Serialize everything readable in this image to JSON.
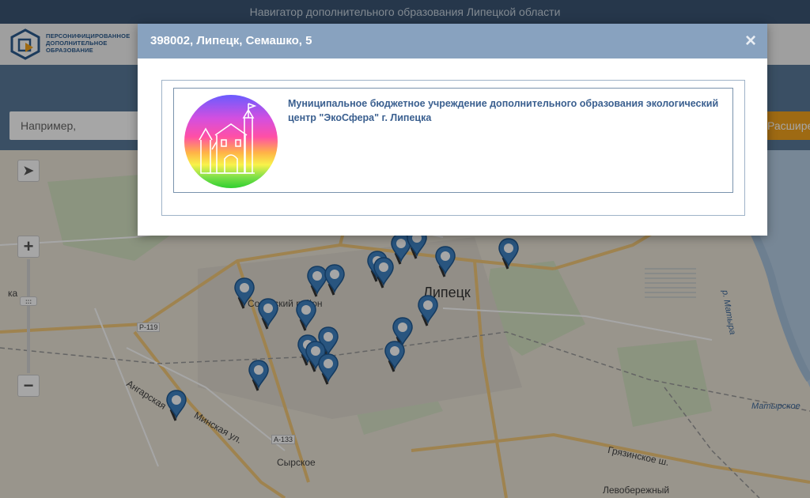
{
  "topbar": {
    "title": "Навигатор дополнительного образования Липецкой области"
  },
  "header": {
    "logo_text": [
      "ПЕРСОНИФИЦИРОВАННОЕ",
      "ДОПОЛНИТЕЛЬНОЕ",
      "ОБРАЗОВАНИЕ"
    ]
  },
  "search": {
    "placeholder": "Например, Робототехника"
  },
  "extended_search": {
    "label": "Расширенный поиск"
  },
  "map": {
    "controls": {
      "zoom_in": "+",
      "zoom_out": "−",
      "locate_icon": "arrow-cursor-icon"
    },
    "labels": {
      "city": "Липецк",
      "district": "Советский район",
      "left_edge": "ка",
      "road_p119": "Р-119",
      "road_a133": "А-133",
      "angarskaya": "Ангарская",
      "minskaya": "Минская ул.",
      "syrskoe": "Сырское",
      "gryazinskoe": "Грязинское ш.",
      "levoberezhny": "Левобережный",
      "matyrskoe": "Матырское",
      "river": "р. Матыра"
    },
    "pin_count": 22
  },
  "modal": {
    "title": "398002, Липецк, Семашко, 5",
    "close": "×",
    "organization": {
      "name": "Муниципальное бюджетное учреждение дополнительного образования экологический центр \"ЭкоСфера\" г. Липецка",
      "logo_icon": "ecosphere-castle-logo"
    }
  },
  "colors": {
    "topbar": "#3b5573",
    "band": "#5a7a9a",
    "modal_header": "#88a2bf",
    "accent": "#f3a41e",
    "pin": "#3f83c4"
  }
}
